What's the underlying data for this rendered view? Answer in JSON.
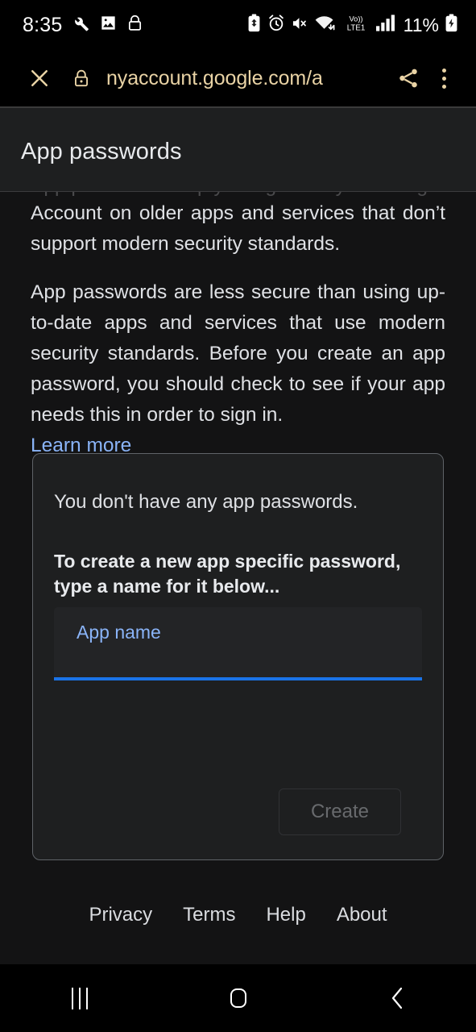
{
  "status_bar": {
    "clock": "8:35",
    "battery_percent": "11%",
    "left_icons": [
      "wrench-icon",
      "image-icon",
      "lock-icon"
    ],
    "right_icons": [
      "battery-saver-icon",
      "alarm-icon",
      "mute-vibrate-icon",
      "wifi-icon",
      "volte-icon",
      "signal-bars-icon",
      "battery-charging-icon"
    ],
    "network_label": "Vo))",
    "network_sublabel": "LTE1"
  },
  "browser": {
    "url": "nyaccount.google.com/a",
    "close_icon": "close-icon",
    "lock_icon": "lock-icon",
    "share_icon": "share-icon",
    "menu_icon": "overflow-menu-icon"
  },
  "page": {
    "title": "App passwords",
    "scrolled_under_line": "App passwords help you sign in to your Google",
    "intro_paragraph_1": "Account on older apps and services that don’t support modern security standards.",
    "intro_paragraph_2": "App passwords are less secure than using up-to-date apps and services that use modern security standards. Before you create an app password, you should check to see if your app needs this in order to sign in.",
    "learn_more_label": "Learn more"
  },
  "card": {
    "empty_state": "You don't have any app passwords.",
    "create_instructions": "To create a new app specific password, type a name for it below...",
    "field_label": "App name",
    "field_value": "",
    "field_placeholder": "",
    "create_button_label": "Create"
  },
  "footer": {
    "links": [
      {
        "label": "Privacy"
      },
      {
        "label": "Terms"
      },
      {
        "label": "Help"
      },
      {
        "label": "About"
      }
    ]
  },
  "nav_bar": {
    "recents_icon": "recents-icon",
    "home_icon": "home-icon",
    "back_icon": "back-icon"
  },
  "colors": {
    "page_background": "#131314",
    "header_background": "#1e1f20",
    "card_background": "#1e1f20",
    "accent_blue": "#1a73e8",
    "link_blue": "#8ab4f8",
    "url_text": "#e9d3a5",
    "body_text": "#dfe1e5",
    "disabled_text": "#686a6d"
  }
}
